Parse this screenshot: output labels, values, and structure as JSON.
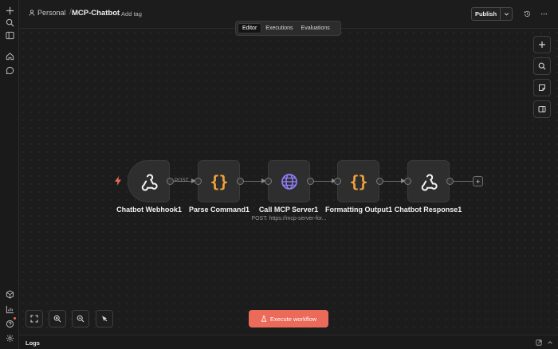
{
  "header": {
    "project": "Personal",
    "separator": "/",
    "workflow_name": "MCP-Chatbot",
    "add_tag": "+ Add tag",
    "publish": "Publish"
  },
  "tabs": [
    "Editor",
    "Executions",
    "Evaluations"
  ],
  "active_tab": "Editor",
  "nodes": [
    {
      "label": "Chatbot Webhook1",
      "icon": "webhook-icon"
    },
    {
      "label": "Parse Command1",
      "icon": "code-braces-icon"
    },
    {
      "label": "Call MCP Server1",
      "icon": "globe-icon",
      "subtitle": "POST: https://mcp-server-for..."
    },
    {
      "label": "Formatting Output1",
      "icon": "code-braces-icon"
    },
    {
      "label": "Chatbot Response1",
      "icon": "webhook-icon"
    }
  ],
  "connection_label": "POST",
  "node_brace": "{}",
  "add_node": "+",
  "execute_button": "Execute workflow",
  "logs_label": "Logs",
  "colors": {
    "accent": "#ec6a5a",
    "brace": "#f2a33a",
    "globe": "#8b7bf2",
    "background": "#1c1c1c"
  }
}
